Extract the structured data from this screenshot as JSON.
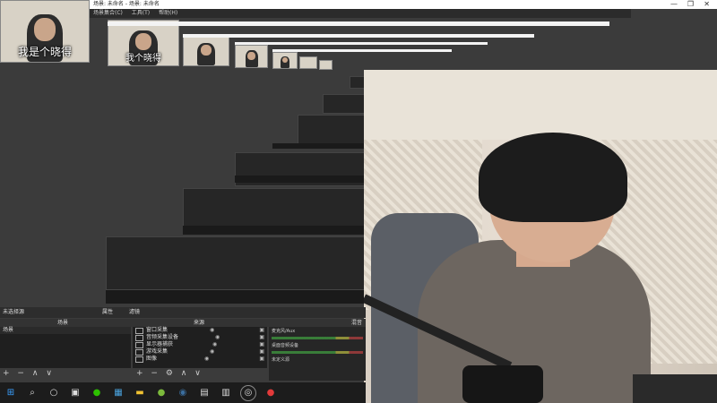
{
  "window": {
    "title": "场景: 未命名 - 场景: 未命名",
    "menu": [
      "场景集合(C)",
      "工具(T)",
      "帮助(H)"
    ],
    "controls": [
      "—",
      "❐",
      "✕"
    ]
  },
  "webcam": {
    "subtitle_large": "我是个晓得",
    "subtitle_small": "我个晓得"
  },
  "obs": {
    "scene_header": "未选择源",
    "buttons": {
      "properties": "属性",
      "filters": "滤镜"
    },
    "panels": {
      "scenes": "场景",
      "sources": "来源",
      "mixer": "混音器"
    },
    "scenes": [
      "场景"
    ],
    "sources": [
      {
        "icon": "window-icon",
        "label": "窗口采集"
      },
      {
        "icon": "audio-input-icon",
        "label": "音频采集设备"
      },
      {
        "icon": "monitor-icon",
        "label": "显示器捕获"
      },
      {
        "icon": "window-icon",
        "label": "游戏采集"
      },
      {
        "icon": "image-icon",
        "label": "图像"
      }
    ],
    "mixer": [
      {
        "label": "麦克风/Aux",
        "level": 0.7
      },
      {
        "label": "桌面音频设备",
        "level": 0.6
      },
      {
        "label": "未定义源",
        "level": 0.0
      }
    ],
    "controls": [
      "+",
      "−",
      "⚙",
      "∧",
      "∨"
    ]
  },
  "taskbar": {
    "icons": [
      {
        "name": "start-icon",
        "glyph": "⊞",
        "color": "#3aa0ff"
      },
      {
        "name": "search-icon",
        "glyph": "⌕",
        "color": "#ddd"
      },
      {
        "name": "cortana-icon",
        "glyph": "○",
        "color": "#ddd"
      },
      {
        "name": "task-view-icon",
        "glyph": "▣",
        "color": "#ddd"
      },
      {
        "name": "wechat-icon",
        "glyph": "●",
        "color": "#2dc100"
      },
      {
        "name": "store-icon",
        "glyph": "▦",
        "color": "#4aa3df"
      },
      {
        "name": "folder-icon",
        "glyph": "▬",
        "color": "#f1c232"
      },
      {
        "name": "xbox-icon",
        "glyph": "●",
        "color": "#7cba3c"
      },
      {
        "name": "steam-icon",
        "glyph": "◉",
        "color": "#3b6e9e"
      },
      {
        "name": "app-icon",
        "glyph": "▤",
        "color": "#ccc"
      },
      {
        "name": "app2-icon",
        "glyph": "▥",
        "color": "#ccc"
      },
      {
        "name": "obs-icon",
        "glyph": "◎",
        "color": "#ddd"
      },
      {
        "name": "netease-icon",
        "glyph": "●",
        "color": "#e23a3a"
      }
    ]
  }
}
